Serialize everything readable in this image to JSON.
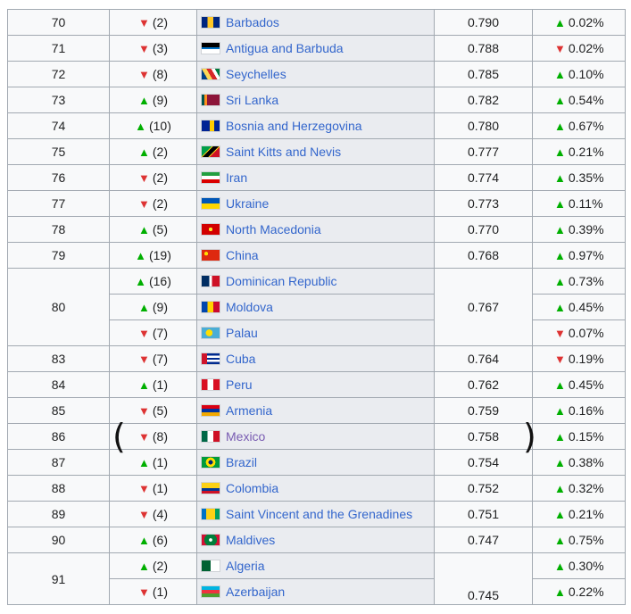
{
  "colors": {
    "up": "#14866d",
    "down": "#dd3333",
    "link": "#3366cc",
    "visited": "#795cb2"
  },
  "rows": [
    {
      "rank": "70",
      "rank_rowspan": 1,
      "change_dir": "down",
      "change": "(2)",
      "country": "Barbados",
      "hdi": "0.790",
      "hdi_rowspan": 1,
      "growth_dir": "up",
      "growth": "0.02%"
    },
    {
      "rank": "71",
      "rank_rowspan": 1,
      "change_dir": "down",
      "change": "(3)",
      "country": "Antigua and Barbuda",
      "hdi": "0.788",
      "hdi_rowspan": 1,
      "growth_dir": "down",
      "growth": "0.02%"
    },
    {
      "rank": "72",
      "rank_rowspan": 1,
      "change_dir": "down",
      "change": "(8)",
      "country": "Seychelles",
      "hdi": "0.785",
      "hdi_rowspan": 1,
      "growth_dir": "up",
      "growth": "0.10%"
    },
    {
      "rank": "73",
      "rank_rowspan": 1,
      "change_dir": "up",
      "change": "(9)",
      "country": "Sri Lanka",
      "hdi": "0.782",
      "hdi_rowspan": 1,
      "growth_dir": "up",
      "growth": "0.54%"
    },
    {
      "rank": "74",
      "rank_rowspan": 1,
      "change_dir": "up",
      "change": "(10)",
      "country": "Bosnia and Herzegovina",
      "hdi": "0.780",
      "hdi_rowspan": 1,
      "growth_dir": "up",
      "growth": "0.67%"
    },
    {
      "rank": "75",
      "rank_rowspan": 1,
      "change_dir": "up",
      "change": "(2)",
      "country": "Saint Kitts and Nevis",
      "hdi": "0.777",
      "hdi_rowspan": 1,
      "growth_dir": "up",
      "growth": "0.21%"
    },
    {
      "rank": "76",
      "rank_rowspan": 1,
      "change_dir": "down",
      "change": "(2)",
      "country": "Iran",
      "hdi": "0.774",
      "hdi_rowspan": 1,
      "growth_dir": "up",
      "growth": "0.35%"
    },
    {
      "rank": "77",
      "rank_rowspan": 1,
      "change_dir": "down",
      "change": "(2)",
      "country": "Ukraine",
      "hdi": "0.773",
      "hdi_rowspan": 1,
      "growth_dir": "up",
      "growth": "0.11%"
    },
    {
      "rank": "78",
      "rank_rowspan": 1,
      "change_dir": "up",
      "change": "(5)",
      "country": "North Macedonia",
      "hdi": "0.770",
      "hdi_rowspan": 1,
      "growth_dir": "up",
      "growth": "0.39%"
    },
    {
      "rank": "79",
      "rank_rowspan": 1,
      "change_dir": "up",
      "change": "(19)",
      "country": "China",
      "hdi": "0.768",
      "hdi_rowspan": 1,
      "growth_dir": "up",
      "growth": "0.97%"
    },
    {
      "rank": "80",
      "rank_rowspan": 3,
      "change_dir": "up",
      "change": "(16)",
      "country": "Dominican Republic",
      "hdi": "0.767",
      "hdi_rowspan": 3,
      "growth_dir": "up",
      "growth": "0.73%"
    },
    {
      "rank": null,
      "change_dir": "up",
      "change": "(9)",
      "country": "Moldova",
      "hdi": null,
      "growth_dir": "up",
      "growth": "0.45%"
    },
    {
      "rank": null,
      "change_dir": "down",
      "change": "(7)",
      "country": "Palau",
      "hdi": null,
      "growth_dir": "down",
      "growth": "0.07%"
    },
    {
      "rank": "83",
      "rank_rowspan": 1,
      "change_dir": "down",
      "change": "(7)",
      "country": "Cuba",
      "hdi": "0.764",
      "hdi_rowspan": 1,
      "growth_dir": "down",
      "growth": "0.19%"
    },
    {
      "rank": "84",
      "rank_rowspan": 1,
      "change_dir": "up",
      "change": "(1)",
      "country": "Peru",
      "hdi": "0.762",
      "hdi_rowspan": 1,
      "growth_dir": "up",
      "growth": "0.45%"
    },
    {
      "rank": "85",
      "rank_rowspan": 1,
      "change_dir": "down",
      "change": "(5)",
      "country": "Armenia",
      "hdi": "0.759",
      "hdi_rowspan": 1,
      "growth_dir": "up",
      "growth": "0.16%"
    },
    {
      "rank": "86",
      "rank_rowspan": 1,
      "change_dir": "down",
      "change": "(8)",
      "country": "Mexico",
      "visited": true,
      "hdi": "0.758",
      "hdi_rowspan": 1,
      "growth_dir": "up",
      "growth": "0.15%"
    },
    {
      "rank": "87",
      "rank_rowspan": 1,
      "change_dir": "up",
      "change": "(1)",
      "country": "Brazil",
      "hdi": "0.754",
      "hdi_rowspan": 1,
      "growth_dir": "up",
      "growth": "0.38%"
    },
    {
      "rank": "88",
      "rank_rowspan": 1,
      "change_dir": "down",
      "change": "(1)",
      "country": "Colombia",
      "hdi": "0.752",
      "hdi_rowspan": 1,
      "growth_dir": "up",
      "growth": "0.32%"
    },
    {
      "rank": "89",
      "rank_rowspan": 1,
      "change_dir": "down",
      "change": "(4)",
      "country": "Saint Vincent and the Grenadines",
      "hdi": "0.751",
      "hdi_rowspan": 1,
      "growth_dir": "up",
      "growth": "0.21%"
    },
    {
      "rank": "90",
      "rank_rowspan": 1,
      "change_dir": "up",
      "change": "(6)",
      "country": "Maldives",
      "hdi": "0.747",
      "hdi_rowspan": 1,
      "growth_dir": "up",
      "growth": "0.75%"
    },
    {
      "rank": "91",
      "rank_rowspan": 3,
      "change_dir": "up",
      "change": "(2)",
      "country": "Algeria",
      "hdi": "0.745",
      "hdi_rowspan": 3,
      "growth_dir": "up",
      "growth": "0.30%"
    },
    {
      "rank": null,
      "change_dir": "down",
      "change": "(1)",
      "country": "Azerbaijan",
      "hdi": null,
      "growth_dir": "up",
      "growth": "0.22%"
    }
  ],
  "annotations": {
    "left_bracket": "(",
    "right_bracket": ")"
  }
}
